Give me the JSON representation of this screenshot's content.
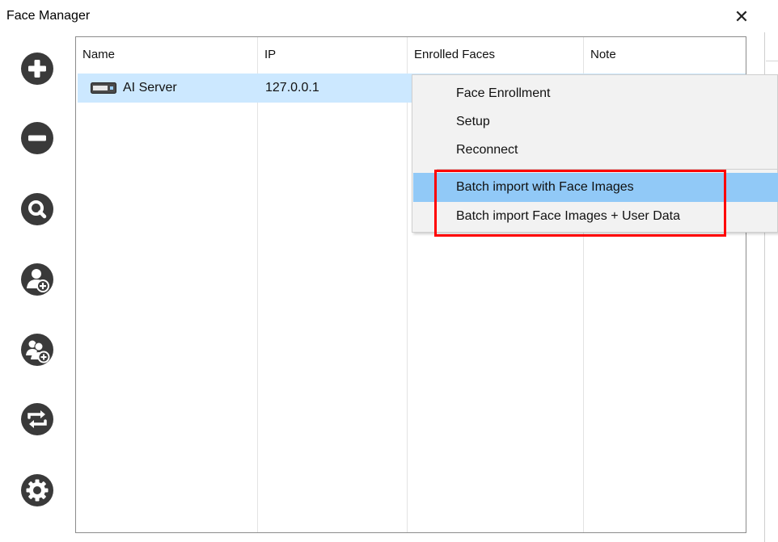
{
  "window": {
    "title": "Face Manager",
    "close_glyph": "✕"
  },
  "toolbar": {
    "buttons": [
      {
        "name": "add-icon"
      },
      {
        "name": "remove-icon"
      },
      {
        "name": "search-icon"
      },
      {
        "name": "add-user-icon"
      },
      {
        "name": "add-users-icon"
      },
      {
        "name": "sync-icon"
      },
      {
        "name": "settings-icon"
      }
    ]
  },
  "list": {
    "columns": [
      "Name",
      "IP",
      "Enrolled Faces",
      "Note"
    ],
    "rows": [
      {
        "icon": "server-icon",
        "name": "AI Server",
        "ip": "127.0.0.1",
        "enrolled_faces": "",
        "note": ""
      }
    ]
  },
  "context_menu": {
    "items": [
      {
        "label": "Face Enrollment"
      },
      {
        "label": "Setup"
      },
      {
        "label": "Reconnect"
      },
      {
        "label": "Batch import with Face Images",
        "highlighted": true
      },
      {
        "label": "Batch import Face Images + User Data"
      }
    ]
  },
  "colors": {
    "selection": "#cce8ff",
    "menu_hover": "#91c9f7",
    "annotation": "#ff0000",
    "icon": "#3a3a3a"
  }
}
